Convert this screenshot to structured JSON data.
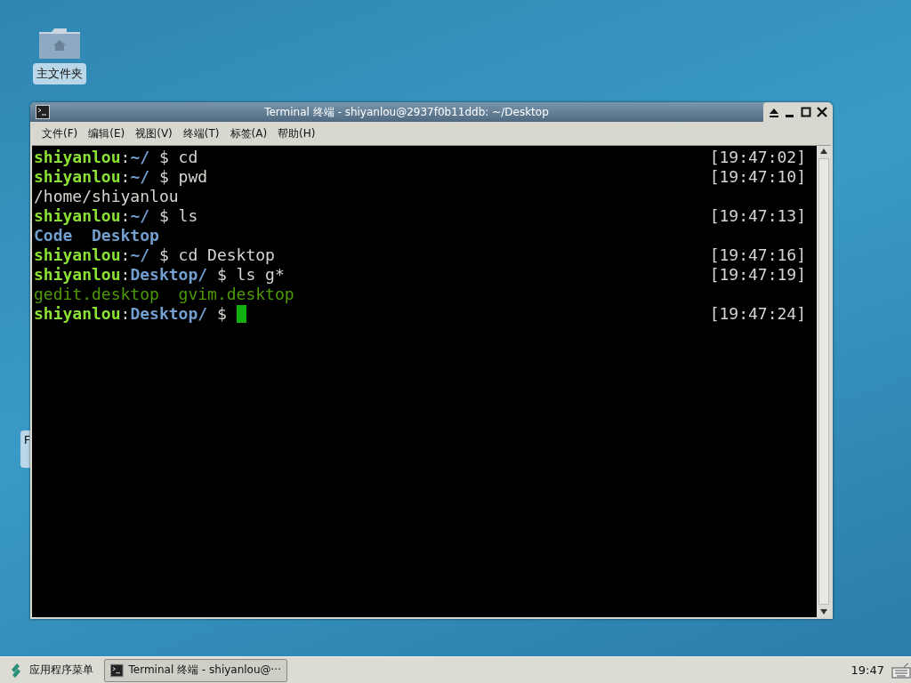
{
  "desktop": {
    "icons": [
      {
        "label": "主文件夹",
        "selected": true
      }
    ],
    "hidden_label": "F"
  },
  "window": {
    "title": "Terminal 终端 - shiyanlou@2937f0b11ddb: ~/Desktop",
    "menu": [
      "文件(F)",
      "编辑(E)",
      "视图(V)",
      "终端(T)",
      "标签(A)",
      "帮助(H)"
    ],
    "lines": [
      {
        "segments": [
          {
            "text": "shiyanlou",
            "color": "#8ae234",
            "bold": true
          },
          {
            "text": ":",
            "color": "#d3d7cf",
            "bold": false
          },
          {
            "text": "~/",
            "color": "#729fcf",
            "bold": true
          },
          {
            "text": " $ cd",
            "color": "#d3d7cf",
            "bold": false
          }
        ],
        "time": "[19:47:02]"
      },
      {
        "segments": [
          {
            "text": "shiyanlou",
            "color": "#8ae234",
            "bold": true
          },
          {
            "text": ":",
            "color": "#d3d7cf",
            "bold": false
          },
          {
            "text": "~/",
            "color": "#729fcf",
            "bold": true
          },
          {
            "text": " $ pwd",
            "color": "#d3d7cf",
            "bold": false
          }
        ],
        "time": "[19:47:10]"
      },
      {
        "segments": [
          {
            "text": "/home/shiyanlou",
            "color": "#d3d7cf",
            "bold": false
          }
        ]
      },
      {
        "segments": [
          {
            "text": "shiyanlou",
            "color": "#8ae234",
            "bold": true
          },
          {
            "text": ":",
            "color": "#d3d7cf",
            "bold": false
          },
          {
            "text": "~/",
            "color": "#729fcf",
            "bold": true
          },
          {
            "text": " $ ls",
            "color": "#d3d7cf",
            "bold": false
          }
        ],
        "time": "[19:47:13]"
      },
      {
        "segments": [
          {
            "text": "Code  Desktop",
            "color": "#729fcf",
            "bold": true
          }
        ]
      },
      {
        "segments": [
          {
            "text": "shiyanlou",
            "color": "#8ae234",
            "bold": true
          },
          {
            "text": ":",
            "color": "#d3d7cf",
            "bold": false
          },
          {
            "text": "~/",
            "color": "#729fcf",
            "bold": true
          },
          {
            "text": " $ cd Desktop",
            "color": "#d3d7cf",
            "bold": false
          }
        ],
        "time": "[19:47:16]"
      },
      {
        "segments": [
          {
            "text": "shiyanlou",
            "color": "#8ae234",
            "bold": true
          },
          {
            "text": ":",
            "color": "#d3d7cf",
            "bold": false
          },
          {
            "text": "Desktop/",
            "color": "#729fcf",
            "bold": true
          },
          {
            "text": " $ ls g*",
            "color": "#d3d7cf",
            "bold": false
          }
        ],
        "time": "[19:47:19]"
      },
      {
        "segments": [
          {
            "text": "gedit.desktop  gvim.desktop",
            "color": "#4e9a06",
            "bold": false
          }
        ]
      },
      {
        "segments": [
          {
            "text": "shiyanlou",
            "color": "#8ae234",
            "bold": true
          },
          {
            "text": ":",
            "color": "#d3d7cf",
            "bold": false
          },
          {
            "text": "Desktop/",
            "color": "#729fcf",
            "bold": true
          },
          {
            "text": " $",
            "color": "#d3d7cf",
            "bold": false
          }
        ],
        "time": "[19:47:24]",
        "cursor": true
      }
    ]
  },
  "taskbar": {
    "menu_label": "应用程序菜单",
    "tasks": [
      {
        "label": "Terminal 终端 - shiyanlou@···",
        "selected": true
      }
    ],
    "clock": "19:47"
  }
}
